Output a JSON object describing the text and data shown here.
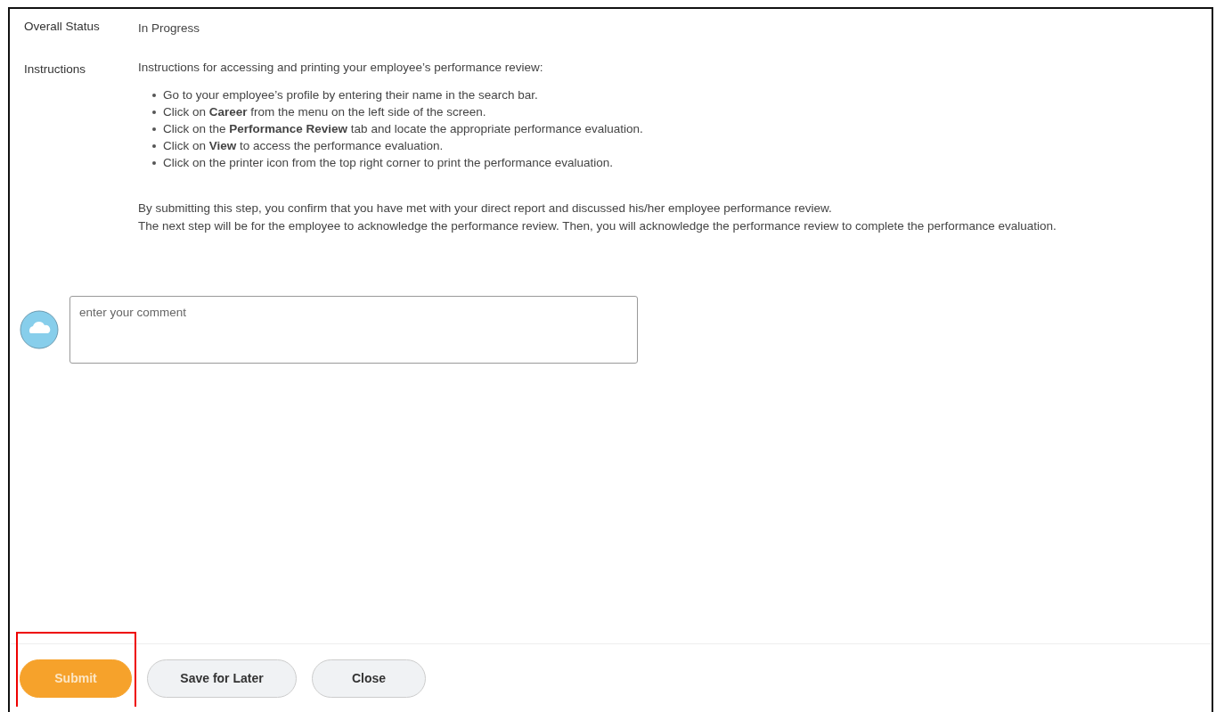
{
  "fields": [
    {
      "label": "Overall Status",
      "value": "In Progress"
    }
  ],
  "instructions": {
    "label": "Instructions",
    "intro": "Instructions for accessing and printing your employee’s performance review:",
    "steps": [
      "Go to your employee’s profile by entering their name in the search bar.",
      "Click on **Career** from the menu on the left side of the screen.",
      "Click on the **Performance Review** tab and locate the appropriate performance evaluation.",
      "Click on **View** to access the performance evaluation.",
      "Click on the printer icon from the top right corner to print the performance evaluation."
    ],
    "notes": [
      "By submitting this step, you confirm that you have met with your direct report and discussed his/her employee performance review.",
      "The next step will be for the employee to acknowledge the performance review. Then, you will acknowledge the performance review to complete the performance evaluation."
    ]
  },
  "comment": {
    "placeholder": "enter your comment"
  },
  "buttons": [
    {
      "label": "Submit",
      "kind": "primary",
      "highlighted": true
    },
    {
      "label": "Save for Later",
      "kind": "secondary",
      "highlighted": false
    },
    {
      "label": "Close",
      "kind": "secondary",
      "highlighted": false
    }
  ]
}
